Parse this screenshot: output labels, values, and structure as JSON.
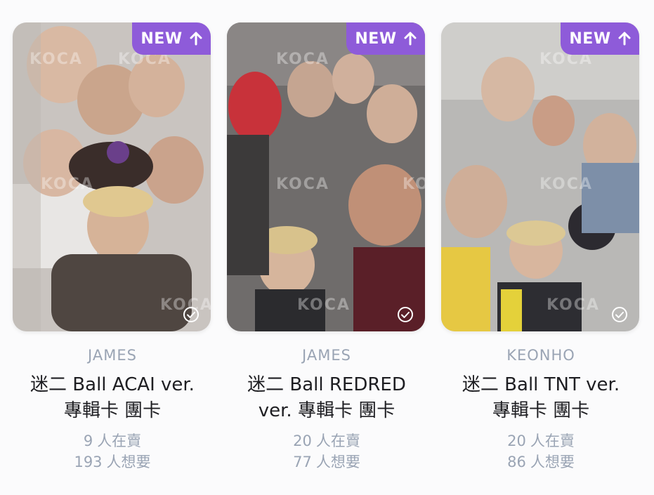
{
  "badge": {
    "label": "NEW",
    "arrow_icon": "arrow-up-icon",
    "color": "#8e5bd9"
  },
  "watermark": "KOCA",
  "cards": [
    {
      "member": "JAMES",
      "title_line1": "迷二 Ball ACAI ver.",
      "title_line2": "專輯卡 團卡",
      "selling_count": "9",
      "selling_label": "人在賣",
      "wanted_count": "193",
      "wanted_label": "人想要"
    },
    {
      "member": "JAMES",
      "title_line1": "迷二 Ball REDRED",
      "title_line2": "ver. 專輯卡 團卡",
      "selling_count": "20",
      "selling_label": "人在賣",
      "wanted_count": "77",
      "wanted_label": "人想要"
    },
    {
      "member": "KEONHO",
      "title_line1": "迷二 Ball TNT ver.",
      "title_line2": "專輯卡 團卡",
      "selling_count": "20",
      "selling_label": "人在賣",
      "wanted_count": "86",
      "wanted_label": "人想要"
    }
  ]
}
